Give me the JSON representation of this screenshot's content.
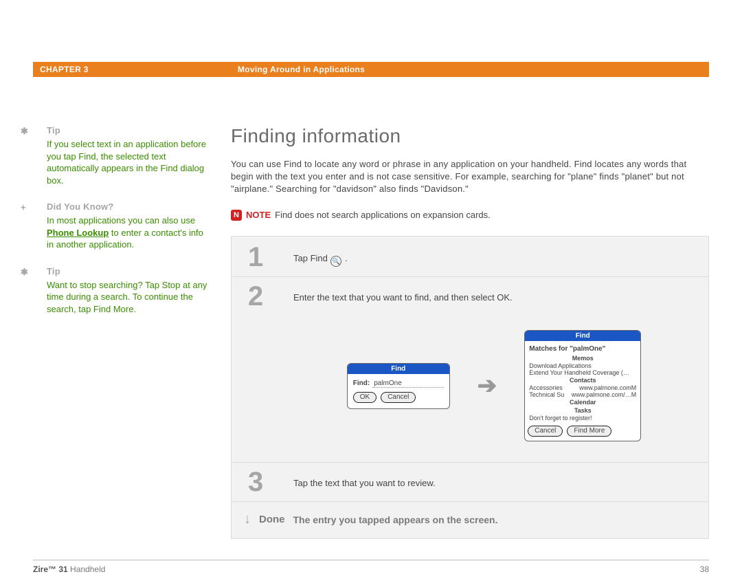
{
  "header": {
    "chapter": "CHAPTER 3",
    "section": "Moving Around in Applications"
  },
  "sidebar": {
    "tip1": {
      "marker": "✱",
      "heading": "Tip",
      "text": "If you select text in an application before you tap Find, the selected text automatically appears in the Find dialog box."
    },
    "dyk": {
      "marker": "+",
      "heading": "Did You Know?",
      "before": "In most applications you can also use ",
      "link": "Phone Lookup",
      "after": " to enter a contact's info in another application."
    },
    "tip2": {
      "marker": "✱",
      "heading": "Tip",
      "text": "Want to stop searching? Tap Stop at any time during a search. To continue the search, tap Find More."
    }
  },
  "main": {
    "title": "Finding information",
    "intro": "You can use Find to locate any word or phrase in any application on your handheld. Find locates any words that begin with the text you enter and is not case sensitive. For example, searching for \"plane\" finds \"planet\" but not \"airplane.\" Searching for \"davidson\" also finds \"Davidson.\"",
    "note": {
      "label": "NOTE",
      "text": "Find does not search applications on expansion cards."
    },
    "steps": {
      "s1": {
        "num": "1",
        "text_before": "Tap Find ",
        "text_after": " ."
      },
      "s2": {
        "num": "2",
        "text": "Enter the text that you want to find, and then select OK.",
        "find_dialog": {
          "title": "Find",
          "label": "Find:",
          "value": "palmOne",
          "ok": "OK",
          "cancel": "Cancel"
        },
        "results_dialog": {
          "title": "Find",
          "header": "Matches for \"palmOne\"",
          "groups": [
            {
              "name": "Memos",
              "items": [
                "Download Applications",
                "Extend Your Handheld Coverage (…"
              ]
            },
            {
              "name": "Contacts",
              "items": [
                {
                  "l": "Accessories",
                  "r": "www.palmone.comM"
                },
                {
                  "l": "Technical Su",
                  "r": "www.palmone.com/…M"
                }
              ]
            },
            {
              "name": "Calendar",
              "items": []
            },
            {
              "name": "Tasks",
              "items": [
                "Don't forget to register!"
              ]
            }
          ],
          "cancel": "Cancel",
          "find_more": "Find More"
        }
      },
      "s3": {
        "num": "3",
        "text": "Tap the text that you want to review."
      }
    },
    "done": {
      "label": "Done",
      "text": "The entry you tapped appears on the screen."
    }
  },
  "footer": {
    "brand_bold": "Zire™ 31",
    "brand_rest": " Handheld",
    "page": "38"
  }
}
